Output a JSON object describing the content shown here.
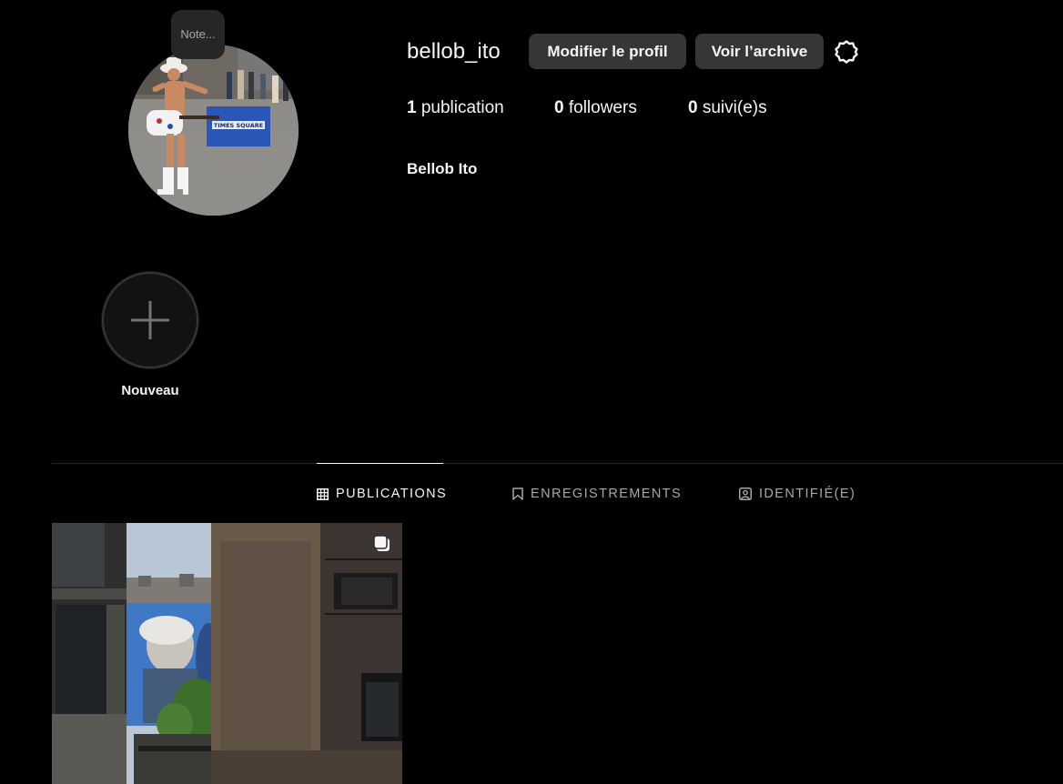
{
  "profile": {
    "username": "bellob_ito",
    "full_name": "Bellob Ito",
    "note_placeholder": "Note...",
    "edit_profile_label": "Modifier le profil",
    "view_archive_label": "Voir l’archive",
    "settings_icon": "gear-icon"
  },
  "stats": {
    "posts_count": "1",
    "posts_label": "publication",
    "followers_count": "0",
    "followers_label": "followers",
    "following_count": "0",
    "following_label": "suivi(e)s"
  },
  "highlights": {
    "new_label": "Nouveau",
    "new_icon": "plus-icon"
  },
  "tabs": [
    {
      "label": "PUBLICATIONS",
      "icon": "grid-icon",
      "active": true
    },
    {
      "label": "ENREGISTREMENTS",
      "icon": "bookmark-icon",
      "active": false
    },
    {
      "label": "IDENTIFIÉ(E)",
      "icon": "tagged-user-icon",
      "active": false
    }
  ],
  "posts": [
    {
      "type": "carousel",
      "icon": "multiple-images-icon"
    }
  ],
  "colors": {
    "background": "#000000",
    "button": "#363636",
    "text_primary": "#f5f5f5",
    "text_secondary": "#a8a8a8",
    "divider": "#262626"
  }
}
